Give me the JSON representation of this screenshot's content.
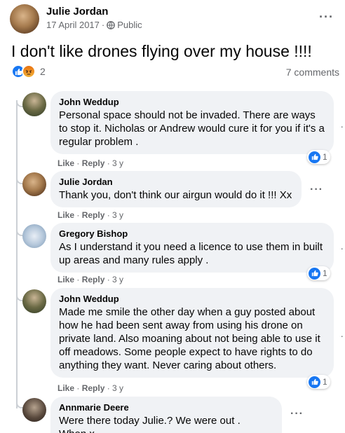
{
  "post": {
    "author": "Julie Jordan",
    "date": "17 April 2017",
    "separator": "·",
    "privacy": "Public",
    "text": "I don't like drones flying over my house !!!!",
    "reaction_count": "2",
    "comments_count": "7 comments"
  },
  "comments": [
    {
      "author": "John Weddup",
      "text": "Personal space should not be invaded. There are ways to stop it. Nicholas or Andrew would cure it for you if it's a regular problem .",
      "like_label": "Like",
      "reply_label": "Reply",
      "time": "3 y",
      "likes": "1"
    },
    {
      "author": "Julie Jordan",
      "text": "Thank you, don't think our airgun would do it !!! Xx",
      "like_label": "Like",
      "reply_label": "Reply",
      "time": "3 y"
    },
    {
      "author": "Gregory Bishop",
      "text": "As I understand it you need a licence to use them in built up areas and many rules apply .",
      "like_label": "Like",
      "reply_label": "Reply",
      "time": "3 y",
      "likes": "1"
    },
    {
      "author": "John Weddup",
      "text": "Made me smile the other day when a guy posted about how he had been sent away from using his drone on private land. Also moaning about not being able to use it off meadows. Some people expect to have rights to do anything they want. Never caring about others.",
      "like_label": "Like",
      "reply_label": "Reply",
      "time": "3 y",
      "likes": "1"
    },
    {
      "author": "Annmarie Deere",
      "text": "Were there today Julie.? We were out . When.x"
    }
  ],
  "icons": {
    "more": "···",
    "globe": "globe-icon",
    "like": "thumbs-up-icon",
    "angry": "angry-face-icon"
  },
  "colors": {
    "like_blue": "#1877f2",
    "bubble": "#f0f2f5",
    "secondary_text": "#65676b"
  }
}
